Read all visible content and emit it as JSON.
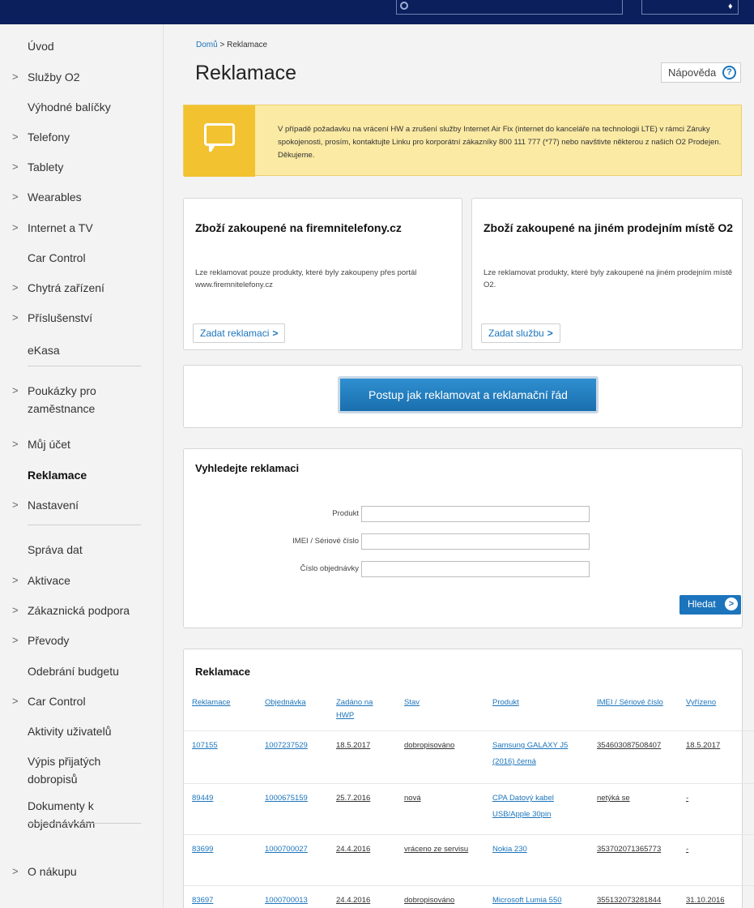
{
  "sidebar": {
    "items": [
      {
        "label": "Úvod",
        "chev": false
      },
      {
        "label": "Služby O2",
        "chev": true
      },
      {
        "label": "Výhodné balíčky",
        "chev": false
      },
      {
        "label": "Telefony",
        "chev": true
      },
      {
        "label": "Tablety",
        "chev": true
      },
      {
        "label": "Wearables",
        "chev": true
      },
      {
        "label": "Internet a TV",
        "chev": true
      },
      {
        "label": "Car Control",
        "chev": false
      },
      {
        "label": "Chytrá zařízení",
        "chev": true
      },
      {
        "label": "Příslušenství",
        "chev": true
      },
      {
        "label": "eKasa",
        "chev": false
      },
      {
        "label": "Poukázky pro zaměstnance",
        "chev": true
      },
      {
        "label": "Můj účet",
        "chev": true
      },
      {
        "label": "Reklamace",
        "chev": false,
        "active": true
      },
      {
        "label": "Nastavení",
        "chev": true
      },
      {
        "label": "Správa dat",
        "chev": false
      },
      {
        "label": "Aktivace",
        "chev": true
      },
      {
        "label": "Zákaznická podpora",
        "chev": true
      },
      {
        "label": "Převody",
        "chev": true
      },
      {
        "label": "Odebrání budgetu",
        "chev": false
      },
      {
        "label": "Car Control",
        "chev": true
      },
      {
        "label": "Aktivity uživatelů",
        "chev": false
      },
      {
        "label": "Výpis přijatých dobropisů",
        "chev": false
      },
      {
        "label": "Dokumenty k objednávkám",
        "chev": false
      },
      {
        "label": "O nákupu",
        "chev": true
      }
    ],
    "chevron": ">"
  },
  "breadcrumb": {
    "home": "Domů",
    "sep": ">",
    "current": "Reklamace"
  },
  "page_title": "Reklamace",
  "help_label": "Nápověda",
  "help_icon": "?",
  "notice_text": "V případě požadavku na vrácení HW a zrušení služby Internet Air Fix (internet do kanceláře na technologii LTE) v rámci Záruky spokojenosti, prosím, kontaktujte Linku pro korporátní zákazníky 800 111 777 (*77) nebo navštivte některou z našich O2 Prodejen. Děkujeme.",
  "card_left": {
    "title": "Zboží zakoupené na firemnitelefony.cz",
    "desc": "Lze reklamovat pouze produkty, které byly zakoupeny přes portál www.firemnitelefony.cz",
    "button": "Zadat reklamaci"
  },
  "card_right": {
    "title": "Zboží zakoupené na jiném prodejním místě O2",
    "desc": "Lze reklamovat produkty, které byly zakoupené na jiném prodejním místě O2.",
    "button": "Zadat službu"
  },
  "procedure_button": "Postup jak reklamovat a reklamační řád",
  "search": {
    "title": "Vyhledejte reklamaci",
    "fields": [
      {
        "label": "Produkt",
        "value": ""
      },
      {
        "label": "IMEI / Sériové číslo",
        "value": ""
      },
      {
        "label": "Číslo objednávky",
        "value": ""
      }
    ],
    "button": "Hledat"
  },
  "table": {
    "title": "Reklamace",
    "headers": [
      "Reklamace",
      "Objednávka",
      "Zadáno na HWP",
      "Stav",
      "Produkt",
      "IMEI / Sériové číslo",
      "Vyřízeno"
    ],
    "rows": [
      [
        "107155",
        "1007237529",
        "18.5.2017",
        "dobropisováno",
        "Samsung GALAXY J5 (2016) černá",
        "354603087508407",
        "18.5.2017"
      ],
      [
        "89449",
        "1000675159",
        "25.7.2016",
        "nová",
        "CPA Datový kabel USB/Apple 30pin",
        "netýká se",
        "-"
      ],
      [
        "83699",
        "1000700027",
        "24.4.2016",
        "vráceno ze servisu",
        "Nokia 230",
        "353702071365773",
        "-"
      ],
      [
        "83697",
        "1000700013",
        "24.4.2016",
        "dobropisováno",
        "Microsoft Lumia 550",
        "355132073281844",
        "31.10.2016"
      ]
    ]
  },
  "colors": {
    "topbar": "#0b1f5c",
    "accent": "#1c75bc",
    "notice_bg": "#fbeaa4",
    "notice_icon": "#f2c230"
  }
}
